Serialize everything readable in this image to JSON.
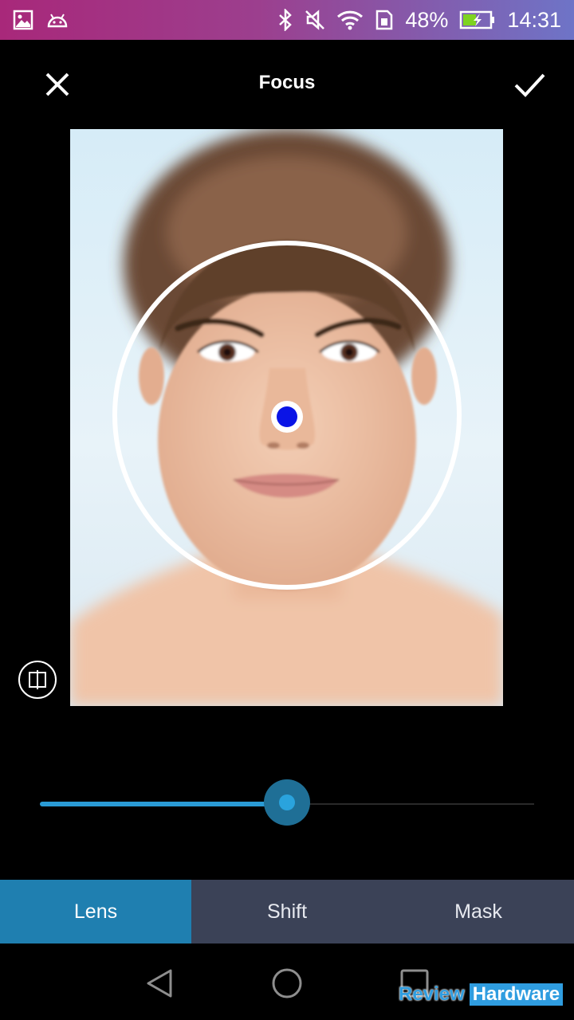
{
  "status_bar": {
    "battery_percent": "48%",
    "time": "14:31",
    "icons_left": [
      "gallery-icon",
      "android-icon"
    ],
    "icons_right": [
      "bluetooth-icon",
      "silent-icon",
      "wifi-icon",
      "sim-icon",
      "battery-charging-icon"
    ]
  },
  "toolbar": {
    "title": "Focus",
    "close_icon": "close-icon",
    "confirm_icon": "check-icon"
  },
  "editor": {
    "compare_icon": "compare-icon",
    "slider_value": 0.5
  },
  "tabs": [
    {
      "label": "Lens",
      "active": true
    },
    {
      "label": "Shift",
      "active": false
    },
    {
      "label": "Mask",
      "active": false
    }
  ],
  "navbar": {
    "back_icon": "back-icon",
    "home_icon": "home-icon",
    "recents_icon": "recents-icon"
  },
  "watermark": {
    "part1": "Review",
    "part2": "Hardware"
  },
  "colors": {
    "accent": "#2a9bd5",
    "active_tab": "#1f7fb0",
    "tab_bar": "#3b4257",
    "focus_point": "#0a14e6"
  }
}
